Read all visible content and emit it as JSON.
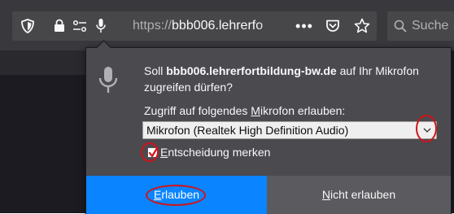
{
  "toolbar": {
    "url_prefix": "https://",
    "url_host": "bbb006.lehrerfo",
    "search_placeholder": "Suche",
    "icons": {
      "shield": "shield-icon",
      "lock": "lock-icon",
      "permissions": "permissions-icon",
      "microphone": "microphone-icon",
      "page_actions": "more-icon",
      "pocket": "pocket-icon",
      "bookmark": "star-icon",
      "search": "search-icon"
    }
  },
  "dialog": {
    "message_prefix": "Soll ",
    "message_host": "bbb006.lehrerfortbildung-bw.de",
    "message_suffix": " auf Ihr Mikrofon zugreifen dürfen?",
    "device_label_before": "Zugriff auf folgendes ",
    "device_label_accesskey": "M",
    "device_label_after": "ikrofon erlauben:",
    "selected_device": "Mikrofon (Realtek High Definition Audio)",
    "remember_accesskey": "E",
    "remember_rest": "ntscheidung merken",
    "remember_checked": true,
    "allow_accesskey": "E",
    "allow_rest": "rlauben",
    "deny_accesskey": "N",
    "deny_rest": "icht erlauben"
  },
  "colors": {
    "toolbar": "#38383d",
    "panel": "#4a4a4f",
    "allow_button": "#0a84ff",
    "deny_button": "#5a5a5f",
    "annotation_ring": "#d0141a"
  }
}
